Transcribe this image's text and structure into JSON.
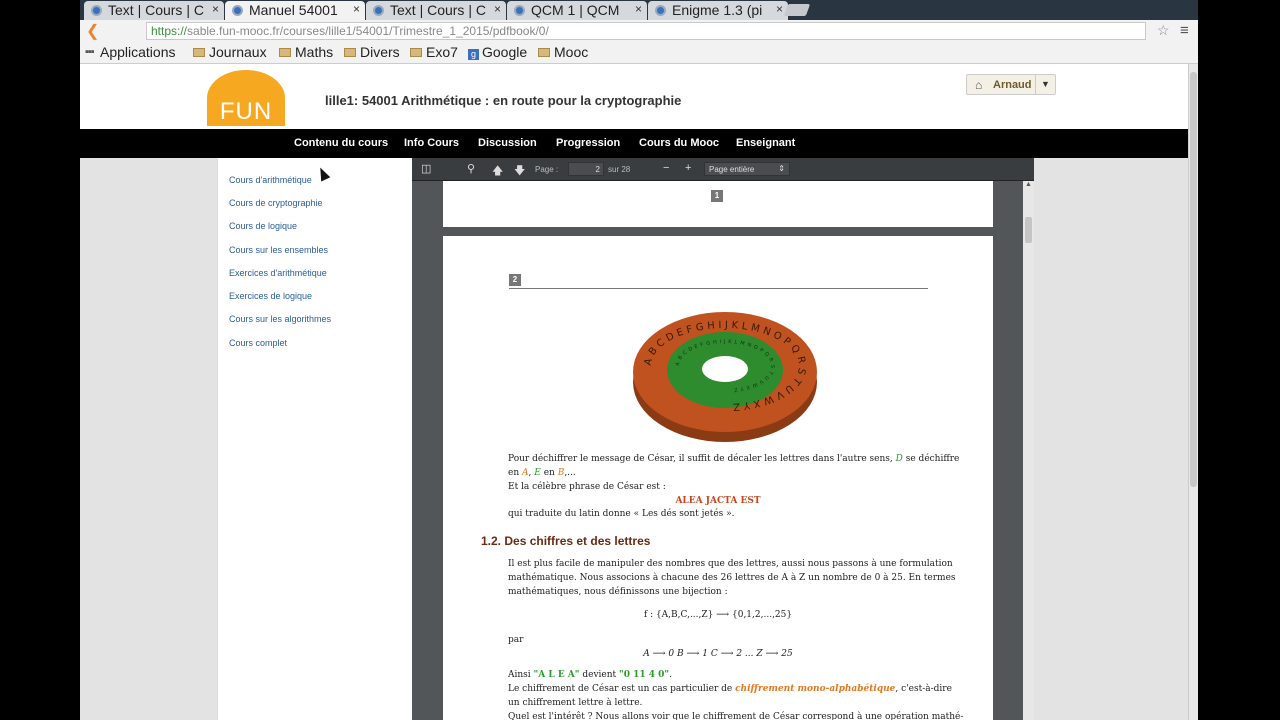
{
  "tabs": [
    {
      "label": "Text | Cours | C",
      "active": false
    },
    {
      "label": "Manuel 54001",
      "active": true
    },
    {
      "label": "Text | Cours | C",
      "active": false
    },
    {
      "label": "QCM 1 | QCM",
      "active": false
    },
    {
      "label": "Enigme 1.3 (pi",
      "active": false
    }
  ],
  "omnibox": {
    "scheme": "https://",
    "url": "sable.fun-mooc.fr/courses/lille1/54001/Trimestre_1_2015/pdfbook/0/"
  },
  "bookmarks": {
    "apps": "Applications",
    "items": [
      "Journaux",
      "Maths",
      "Divers",
      "Exo7",
      "Google",
      "Mooc"
    ]
  },
  "header": {
    "logo_text": "FUN",
    "course_title": "lille1: 54001 Arithmétique : en route pour la cryptographie",
    "user_name": "Arnaud"
  },
  "nav": [
    "Contenu du cours",
    "Info Cours",
    "Discussion",
    "Progression",
    "Cours du Mooc",
    "Enseignant"
  ],
  "sidebar": [
    "Cours d'arithmétique",
    "Cours de cryptographie",
    "Cours de logique",
    "Cours sur les ensembles",
    "Exercices d'arithmétique",
    "Exercices de logique",
    "Cours sur les algorithmes",
    "Cours complet"
  ],
  "pdf_toolbar": {
    "page_label": "Page :",
    "page_value": "2",
    "page_total": "sur 28",
    "zoom_label": "Page entière"
  },
  "pdf": {
    "page1_badge": "1",
    "page2_badge": "2",
    "disc_outer_letters": "ABCDEFGHIJKLMNOPQRSTUVWXYZ",
    "para1_a": "Pour déchiffrer le message de César, il suffit de décaler les lettres dans l'autre sens,",
    "para1_D": "D",
    "para1_b": "se déchiffre",
    "para1_c_pre": "en",
    "para1_A": "A",
    "para1_E": "E",
    "para1_en": "en",
    "para1_B": "B",
    "para1_dots": ",...",
    "para2": "Et la célèbre phrase de César est :",
    "alea": "ALEA JACTA EST",
    "para3": "qui traduite du latin donne « Les dés sont jetés ».",
    "section": "1.2. Des chiffres et des lettres",
    "para4_l1": "Il est plus facile de manipuler des nombres que des lettres, aussi nous passons à une formulation",
    "para4_l2": "mathématique. Nous associons à chacune des 26 lettres de A à Z un nombre de 0 à 25. En termes",
    "para4_l3": "mathématiques, nous définissons une bijection :",
    "formula": "f : {A,B,C,...,Z} ⟶ {0,1,2,...,25}",
    "par": "par",
    "mapping": "A ⟶ 0   B ⟶ 1   C ⟶ 2   ...   Z ⟶ 25",
    "ainsi_pre": "Ainsi",
    "ainsi_alea": "\"A L E A\"",
    "ainsi_mid": "devient",
    "ainsi_num": "\"0 11 4 0\"",
    "ainsi_end": ".",
    "l6_pre": "Le chiffrement de César est un cas particulier de",
    "l6_term": "chiffrement mono-alphabétique",
    "l6_post": ", c'est-à-dire",
    "l7": "un chiffrement lettre à lettre.",
    "l8": "Quel est l'intérêt ? Nous allons voir que le chiffrement de César correspond à une opération mathé-"
  },
  "colors": {
    "accent": "#f7a821",
    "nav_bg": "#000000",
    "link": "#2a5d9a",
    "disc_outer": "#c0521f",
    "disc_inner": "#2e8b2e"
  }
}
